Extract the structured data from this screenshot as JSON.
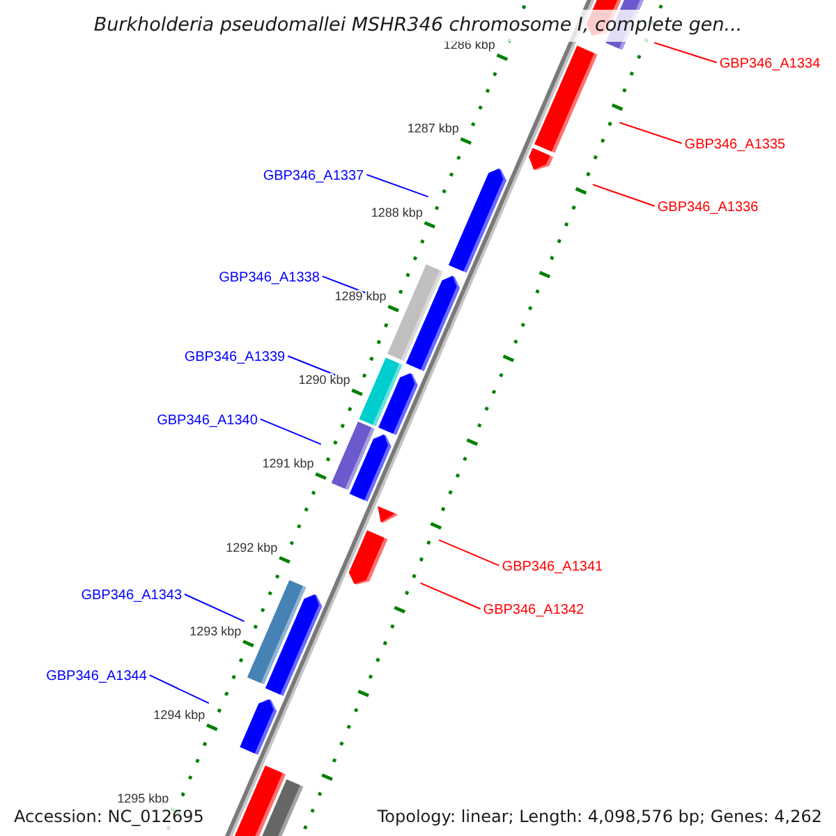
{
  "title": "Burkholderia pseudomallei MSHR346 chromosome I, complete gen...",
  "ruler": {
    "tick_labels": [
      "1286 kbp",
      "1287 kbp",
      "1288 kbp",
      "1289 kbp",
      "1290 kbp",
      "1291 kbp",
      "1292 kbp",
      "1293 kbp",
      "1294 kbp",
      "1295 kbp"
    ]
  },
  "genes": [
    {
      "label": "GBP346_A1334",
      "kind": "forward",
      "color": "#6a5acd"
    },
    {
      "label": "GBP346_A1335",
      "kind": "forward"
    },
    {
      "label": "GBP346_A1336",
      "kind": "forward"
    },
    {
      "label": "GBP346_A1337",
      "kind": "reverse"
    },
    {
      "label": "GBP346_A1338",
      "kind": "reverse",
      "color": "#c0c0c0"
    },
    {
      "label": "GBP346_A1339",
      "kind": "reverse",
      "color": "#00cdcd"
    },
    {
      "label": "GBP346_A1340",
      "kind": "reverse",
      "color": "#6a5acd"
    },
    {
      "label": "GBP346_A1341",
      "kind": "forward"
    },
    {
      "label": "GBP346_A1342",
      "kind": "forward"
    },
    {
      "label": "GBP346_A1343",
      "kind": "reverse",
      "color": "#4682b4"
    },
    {
      "label": "GBP346_A1344",
      "kind": "reverse"
    },
    {
      "kind": "forward",
      "color": "#666666"
    }
  ],
  "footer": {
    "accession": "Accession: NC_012695",
    "summary": "Topology: linear; Length: 4,098,576 bp; Genes: 4,262"
  }
}
